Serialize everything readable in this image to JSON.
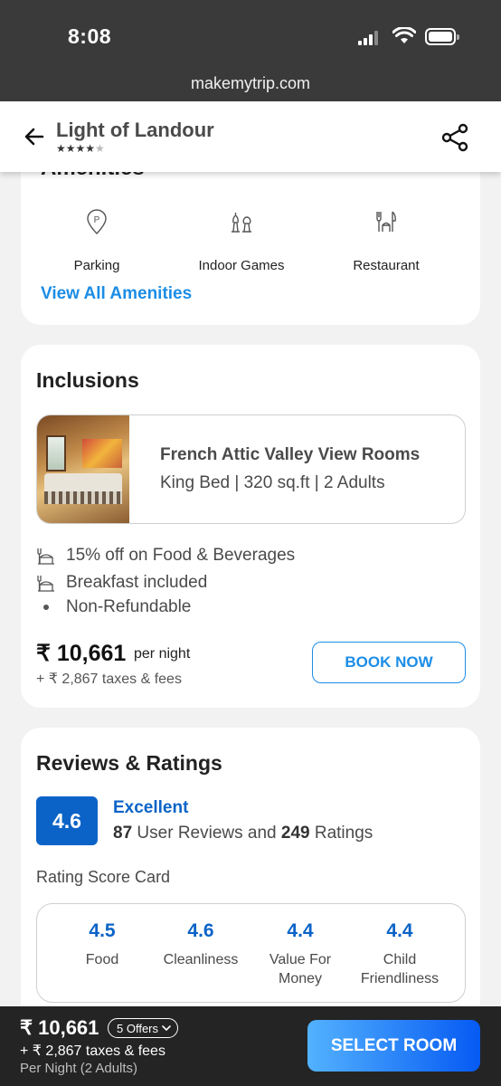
{
  "status_bar": {
    "time": "8:08"
  },
  "browser": {
    "url": "makemytrip.com"
  },
  "header": {
    "hotel_name": "Light of Landour",
    "stars_filled": "★★★★",
    "stars_empty": "★",
    "star_rating": 4
  },
  "amenities": {
    "title_partial": "Amenities",
    "items": [
      {
        "label": "Parking",
        "icon": "parking-icon"
      },
      {
        "label": "Indoor Games",
        "icon": "indoor-games-icon"
      },
      {
        "label": "Restaurant",
        "icon": "restaurant-icon"
      }
    ],
    "view_all": "View All Amenities"
  },
  "inclusions": {
    "title": "Inclusions",
    "room_name": "French Attic Valley View Rooms",
    "room_meta": "King Bed | 320 sq.ft | 2 Adults",
    "lines": [
      {
        "text": "15% off on Food & Beverages",
        "icon": "food-icon"
      },
      {
        "text": "Breakfast included",
        "icon": "food-icon"
      },
      {
        "text": "Non-Refundable",
        "icon": "bullet"
      }
    ],
    "price": "₹ 10,661",
    "per_night": "per night",
    "taxes": "+ ₹ 2,867 taxes & fees",
    "book_label": "BOOK NOW"
  },
  "reviews": {
    "title": "Reviews & Ratings",
    "score": "4.6",
    "rating_label": "Excellent",
    "review_count": "87",
    "reviews_text": " User Reviews and ",
    "rating_count": "249",
    "ratings_text": " Ratings",
    "score_card_title": "Rating Score Card",
    "score_card": [
      {
        "value": "4.5",
        "label": "Food"
      },
      {
        "value": "4.6",
        "label": "Cleanliness"
      },
      {
        "value": "4.4",
        "label": "Value For Money"
      },
      {
        "value": "4.4",
        "label": "Child Friendliness"
      }
    ]
  },
  "bottom_bar": {
    "price": "₹ 10,661",
    "offers": "5 Offers",
    "taxes": "+ ₹ 2,867 taxes & fees",
    "per_night": "Per Night (2 Adults)",
    "select_label": "SELECT ROOM"
  },
  "colors": {
    "accent_blue": "#1c8de6",
    "rating_blue": "#0b63c7",
    "dark_bar": "#242424"
  }
}
